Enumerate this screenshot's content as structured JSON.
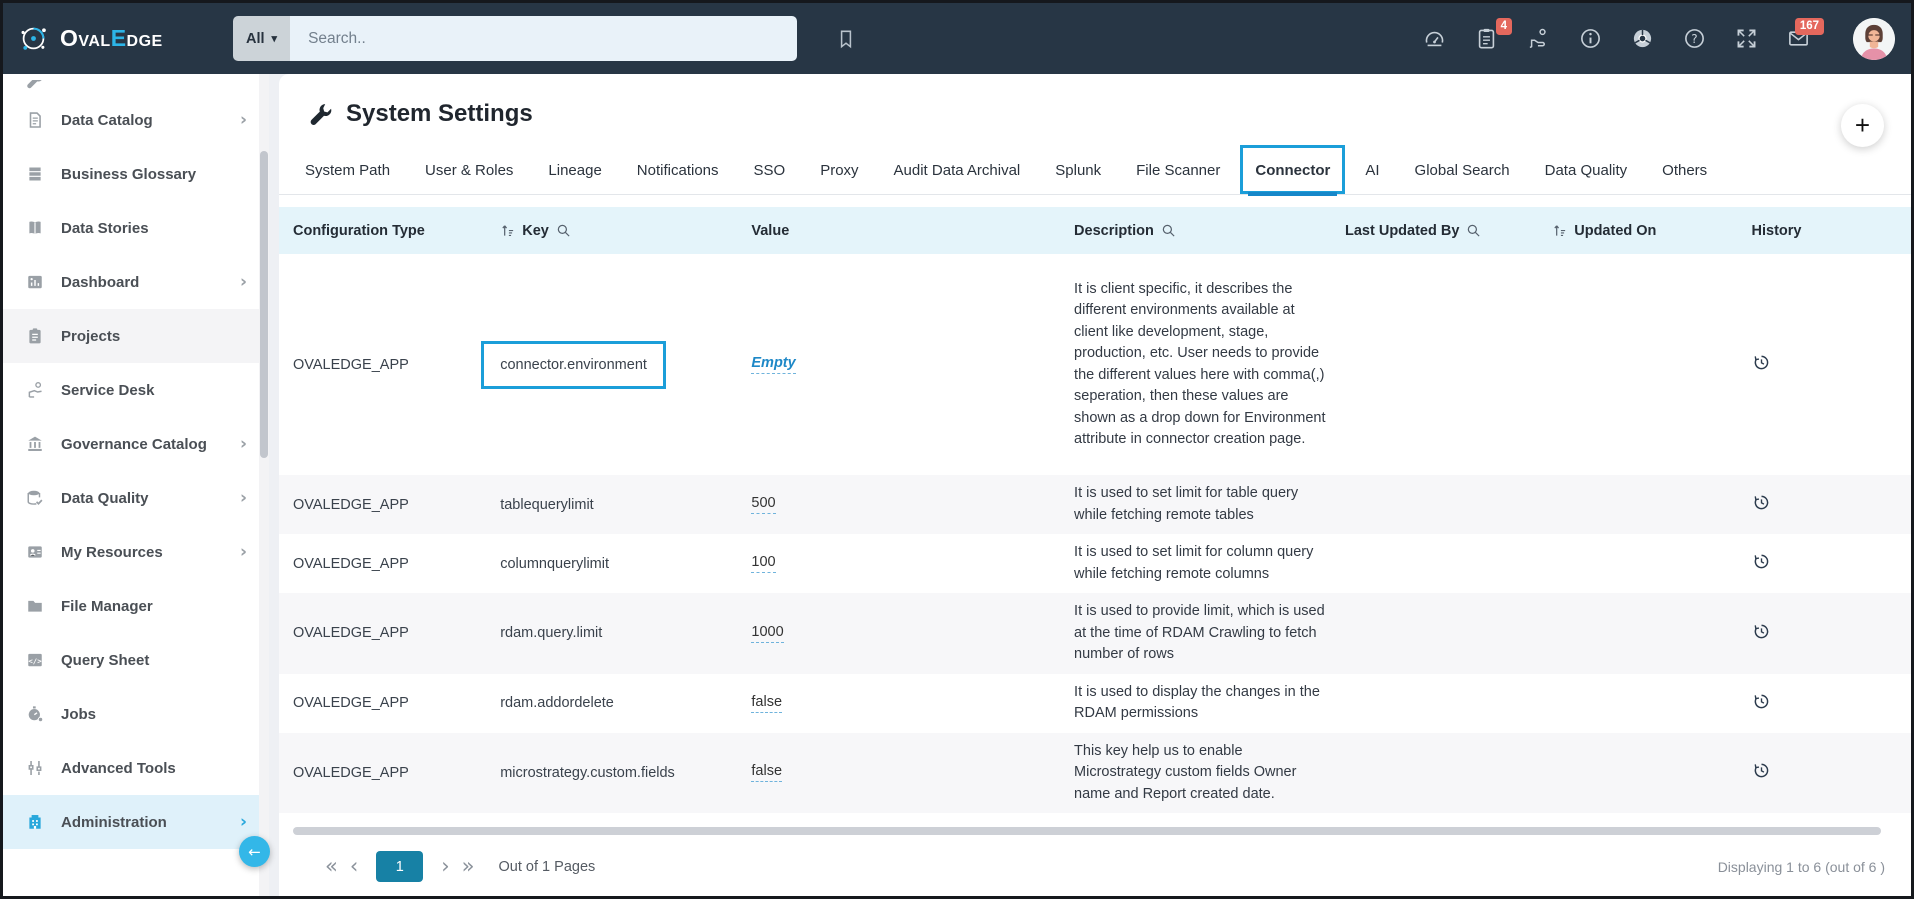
{
  "colors": {
    "annotation_blue": "#1b9ed9",
    "active_tab_underline": "#1687c9",
    "brand_accent": "#2cb5e8",
    "badge_red": "#e4685d",
    "active_page_teal": "#1781a5",
    "link_blue": "#1e88c7",
    "table_header_bg": "#e4f4fa",
    "topbar_bg": "#273645"
  },
  "topbar": {
    "brand": {
      "pre": "Oval",
      "accent": "E",
      "post": "dge"
    },
    "search": {
      "filter_label": "All",
      "placeholder": "Search.."
    },
    "clipboard_badge": "4",
    "mail_badge": "167",
    "icons": [
      "speedometer-icon",
      "clipboard-icon",
      "endorse-icon",
      "info-icon",
      "chrome-icon",
      "help-icon",
      "expand-icon",
      "mail-icon"
    ]
  },
  "sidebar": {
    "items": [
      {
        "label": "",
        "icon": "wrench",
        "partial": true
      },
      {
        "label": "Data Catalog",
        "icon": "data-catalog",
        "chevron": true
      },
      {
        "label": "Business Glossary",
        "icon": "business-glossary"
      },
      {
        "label": "Data Stories",
        "icon": "data-stories"
      },
      {
        "label": "Dashboard",
        "icon": "dashboard",
        "chevron": true
      },
      {
        "label": "Projects",
        "icon": "projects",
        "active": "gray"
      },
      {
        "label": "Service Desk",
        "icon": "service-desk"
      },
      {
        "label": "Governance Catalog",
        "icon": "governance-catalog",
        "chevron": true
      },
      {
        "label": "Data Quality",
        "icon": "data-quality",
        "chevron": true
      },
      {
        "label": "My Resources",
        "icon": "my-resources",
        "chevron": true
      },
      {
        "label": "File Manager",
        "icon": "file-manager"
      },
      {
        "label": "Query Sheet",
        "icon": "query-sheet"
      },
      {
        "label": "Jobs",
        "icon": "jobs"
      },
      {
        "label": "Advanced Tools",
        "icon": "advanced-tools"
      },
      {
        "label": "Administration",
        "icon": "administration",
        "chevron": true,
        "active": "blue"
      }
    ]
  },
  "main": {
    "title": "System Settings",
    "tabs": [
      {
        "label": "System Path"
      },
      {
        "label": "User & Roles"
      },
      {
        "label": "Lineage"
      },
      {
        "label": "Notifications"
      },
      {
        "label": "SSO"
      },
      {
        "label": "Proxy"
      },
      {
        "label": "Audit Data Archival"
      },
      {
        "label": "Splunk"
      },
      {
        "label": "File Scanner"
      },
      {
        "label": "Connector",
        "active": true,
        "annotated": true
      },
      {
        "label": "AI"
      },
      {
        "label": "Global Search"
      },
      {
        "label": "Data Quality"
      },
      {
        "label": "Others"
      }
    ],
    "table": {
      "columns": [
        {
          "label": "Configuration Type"
        },
        {
          "label": "Key",
          "sort": true,
          "search": true
        },
        {
          "label": "Value"
        },
        {
          "label": "Description",
          "search": true
        },
        {
          "label": "Last Updated By",
          "search": true
        },
        {
          "label": "Updated On",
          "sort": true
        },
        {
          "label": "History"
        }
      ],
      "rows": [
        {
          "configuration_type": "OVALEDGE_APP",
          "key": "connector.environment",
          "key_annotated": true,
          "value": "Empty",
          "value_is_empty": true,
          "description": "It is client specific, it describes the different environments available at client like development, stage, production, etc. User needs to provide the different values here with comma(,) seperation, then these values are shown as a drop down for Environment attribute in connector creation page.",
          "last_updated_by": "",
          "updated_on": "",
          "tall": true
        },
        {
          "configuration_type": "OVALEDGE_APP",
          "key": "tablequerylimit",
          "value": "500",
          "description": "It is used to set limit for table query while fetching remote tables",
          "last_updated_by": "",
          "updated_on": ""
        },
        {
          "configuration_type": "OVALEDGE_APP",
          "key": "columnquerylimit",
          "value": "100",
          "description": "It is used to set limit for column query while fetching remote columns",
          "last_updated_by": "",
          "updated_on": ""
        },
        {
          "configuration_type": "OVALEDGE_APP",
          "key": "rdam.query.limit",
          "value": "1000",
          "description": "It is used to provide limit, which is used at the time of RDAM Crawling to fetch number of rows",
          "last_updated_by": "",
          "updated_on": ""
        },
        {
          "configuration_type": "OVALEDGE_APP",
          "key": "rdam.addordelete",
          "value": "false",
          "description": "It is used to display the changes in the RDAM permissions",
          "last_updated_by": "",
          "updated_on": ""
        },
        {
          "configuration_type": "OVALEDGE_APP",
          "key": "microstrategy.custom.fields",
          "value": "false",
          "description": "This key help us to enable Microstrategy custom fields Owner name and Report created date.",
          "last_updated_by": "",
          "updated_on": ""
        }
      ]
    },
    "pagination": {
      "page": "1",
      "out_of_label": "Out of 1 Pages",
      "displaying": "Displaying 1 to 6 (out of  6 )"
    }
  }
}
